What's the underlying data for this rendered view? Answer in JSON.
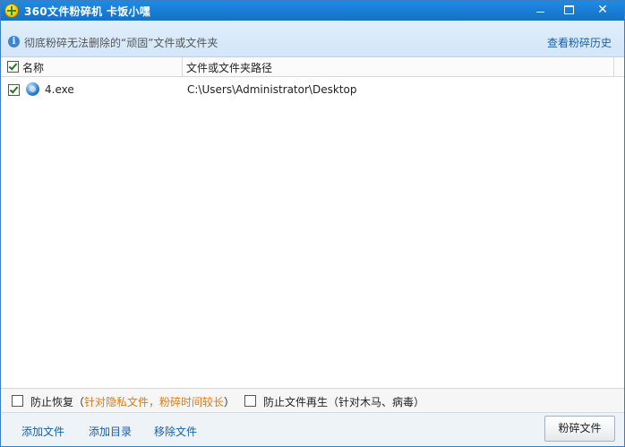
{
  "window": {
    "title": "360文件粉碎机  卡饭小嘿",
    "min_icon": "minimize-icon",
    "max_icon": "maximize-icon",
    "close_glyph": "✕"
  },
  "infobar": {
    "icon": "i",
    "text": "彻底粉碎无法删除的“顽固”文件或文件夹",
    "history_link": "查看粉碎历史"
  },
  "table": {
    "columns": [
      "名称",
      "文件或文件夹路径"
    ],
    "header_checked": true,
    "rows": [
      {
        "checked": true,
        "name": "4.exe",
        "path": "C:\\Users\\Administrator\\Desktop"
      }
    ]
  },
  "options": {
    "prevent_recovery": {
      "label": "防止恢复",
      "note_open": "（",
      "note": "针对隐私文件，粉碎时间较长",
      "note_close": "）",
      "checked": false
    },
    "prevent_regen": {
      "label": "防止文件再生",
      "note": "（针对木马、病毒）",
      "checked": false
    }
  },
  "bottom": {
    "add_file": "添加文件",
    "add_dir": "添加目录",
    "remove_file": "移除文件",
    "shred_button": "粉碎文件"
  },
  "colors": {
    "titlebar": "#1a7fd8",
    "link": "#1b5fa8",
    "warning": "#e07a10"
  }
}
